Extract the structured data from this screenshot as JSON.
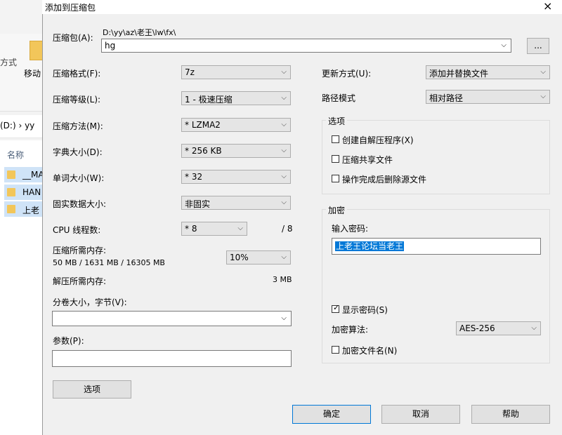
{
  "explorer": {
    "ribbon_text": "方式",
    "move_label": "移动",
    "address": "(D:)  ›  yy",
    "column_name": "名称",
    "files": [
      "__MA",
      "HAN",
      "上老"
    ]
  },
  "dialog": {
    "title": "添加到压缩包",
    "close_glyph": "×",
    "archive_label": "压缩包(A):",
    "archive_path": "D:\\yy\\az\\老王\\lw\\fx\\",
    "archive_name": "hg",
    "browse_label": "...",
    "format_label": "压缩格式(F):",
    "format_value": "7z",
    "level_label": "压缩等级(L):",
    "level_value": "1 - 极速压缩",
    "method_label": "压缩方法(M):",
    "method_value": "* LZMA2",
    "dict_label": "字典大小(D):",
    "dict_value": "* 256 KB",
    "word_label": "单词大小(W):",
    "word_value": "* 32",
    "solid_label": "固实数据大小:",
    "solid_value": "非固实",
    "threads_label": "CPU 线程数:",
    "threads_value": "* 8",
    "threads_total": "/ 8",
    "mem_label": "压缩所需内存:",
    "mem_detail": "50 MB / 1631 MB / 16305 MB",
    "mem_percent": "10%",
    "decomp_label": "解压所需内存:",
    "decomp_value": "3 MB",
    "split_label": "分卷大小，字节(V):",
    "split_value": "",
    "params_label": "参数(P):",
    "params_value": "",
    "options_button": "选项",
    "update_label": "更新方式(U):",
    "update_value": "添加并替换文件",
    "path_label": "路径模式",
    "path_value": "相对路径",
    "options_group": "选项",
    "opt_sfx": "创建自解压程序(X)",
    "opt_shared": "压缩共享文件",
    "opt_delete": "操作完成后删除源文件",
    "encrypt_group": "加密",
    "password_label": "输入密码:",
    "password_value": "上老王论坛当老王",
    "show_password": "显示密码(S)",
    "encrypt_method_label": "加密算法:",
    "encrypt_method_value": "AES-256",
    "encrypt_names": "加密文件名(N)",
    "ok": "确定",
    "cancel": "取消",
    "help": "帮助"
  }
}
